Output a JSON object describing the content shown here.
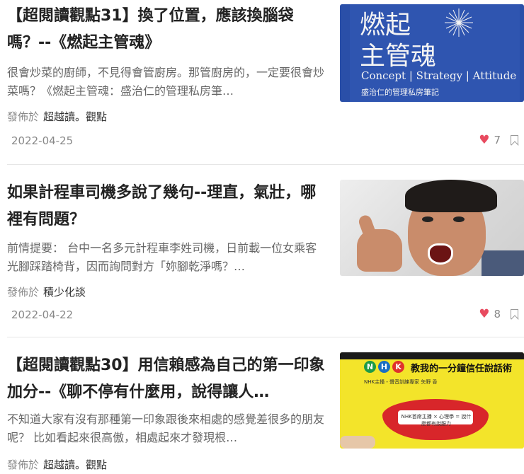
{
  "articles": [
    {
      "title": "【超閱讀觀點31】換了位置，應該換腦袋嗎？--《燃起主管魂》",
      "excerpt": "很會炒菜的廚師，不見得會管廚房。那管廚房的，一定要很會炒菜嗎？《燃起主管魂：盛治仁的管理私房筆…",
      "published_label": "發佈於",
      "author": "超越讀。觀點",
      "date": "2022-04-25",
      "likes": "7",
      "thumb": {
        "cover_title_line1": "燃起",
        "cover_title_line2": "主管魂",
        "cover_en": "Concept | Strategy | Attitude",
        "cover_sub": "盛治仁的管理私房筆記"
      }
    },
    {
      "title": "如果計程車司機多說了幾句--理直，氣壯，哪裡有問題？",
      "excerpt": "前情提要： 台中一名多元計程車李姓司機，日前載一位女乘客光腳踩踏椅背，因而詢問對方「妳腳乾淨嗎？…",
      "published_label": "發佈於",
      "author": "積少化談",
      "date": "2022-04-22",
      "likes": "8"
    },
    {
      "title": "【超閱讀觀點30】用信賴感為自己的第一印象加分--《聊不停有什麼用，說得讓人…",
      "excerpt": "不知道大家有沒有那種第一印象跟後來相處的感覺差很多的朋友呢？ 比如看起來很高傲，相處起來才發現根…",
      "published_label": "發佈於",
      "author": "超越讀。觀點",
      "thumb": {
        "nhk_letters": [
          "N",
          "H",
          "K"
        ],
        "cover_title": "教我的一分鐘信任說話術",
        "cover_small": "NHK主播・聲音訓練專家 矢野 香",
        "lips_label": "NHK首席主播 × 心理學 = 說什麼都有說服力"
      }
    }
  ],
  "colors": {
    "like_heart": "#e84a5f",
    "text_muted": "#888888",
    "title": "#222222"
  }
}
